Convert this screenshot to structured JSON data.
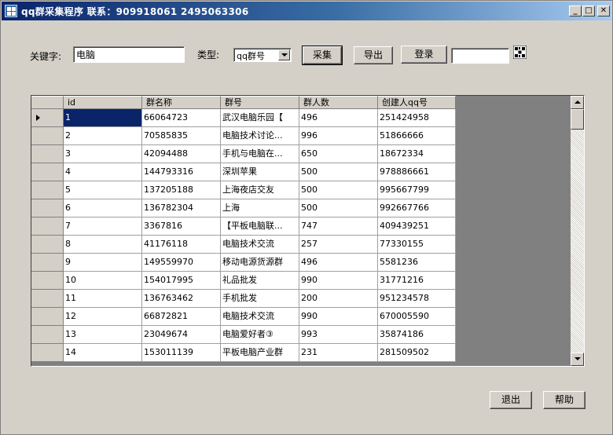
{
  "window": {
    "title": "qq群采集程序 联系：909918061 2495063306",
    "minimize_glyph": "_",
    "maximize_glyph": "□",
    "close_glyph": "✕"
  },
  "search": {
    "keyword_label": "关键字:",
    "keyword_value": "电脑",
    "type_label": "类型:",
    "type_selected": "qq群号",
    "collect_label": "采集",
    "export_label": "导出",
    "login_label": "登录",
    "extra_value": ""
  },
  "grid": {
    "columns": [
      "id",
      "群名称",
      "群号",
      "群人数",
      "创建人qq号"
    ],
    "rows": [
      [
        "1",
        "66064723",
        "武汉电脑乐园【",
        "496",
        "251424958"
      ],
      [
        "2",
        "70585835",
        "电脑技术讨论...",
        "996",
        "51866666"
      ],
      [
        "3",
        "42094488",
        "手机与电脑在...",
        "650",
        "18672334"
      ],
      [
        "4",
        "144793316",
        "深圳苹果",
        "500",
        "978886661"
      ],
      [
        "5",
        "137205188",
        "上海夜店交友",
        "500",
        "995667799"
      ],
      [
        "6",
        "136782304",
        "上海",
        "500",
        "992667766"
      ],
      [
        "7",
        "3367816",
        "【平板电脑联...",
        "747",
        "409439251"
      ],
      [
        "8",
        "41176118",
        "电脑技术交流",
        "257",
        "77330155"
      ],
      [
        "9",
        "149559970",
        "移动电源货源群",
        "496",
        "5581236"
      ],
      [
        "10",
        "154017995",
        "礼品批发",
        "990",
        "31771216"
      ],
      [
        "11",
        "136763462",
        "手机批发",
        "200",
        "951234578"
      ],
      [
        "12",
        "66872821",
        "电脑技术交流",
        "990",
        "670005590"
      ],
      [
        "13",
        "23049674",
        "电脑爱好者③",
        "993",
        "35874186"
      ],
      [
        "14",
        "153011139",
        "平板电脑产业群",
        "231",
        "281509502"
      ]
    ]
  },
  "footer": {
    "exit_label": "退出",
    "help_label": "帮助"
  },
  "colors": {
    "selection": "#0a246a",
    "face": "#d4d0c8",
    "grid_background": "#808080"
  }
}
